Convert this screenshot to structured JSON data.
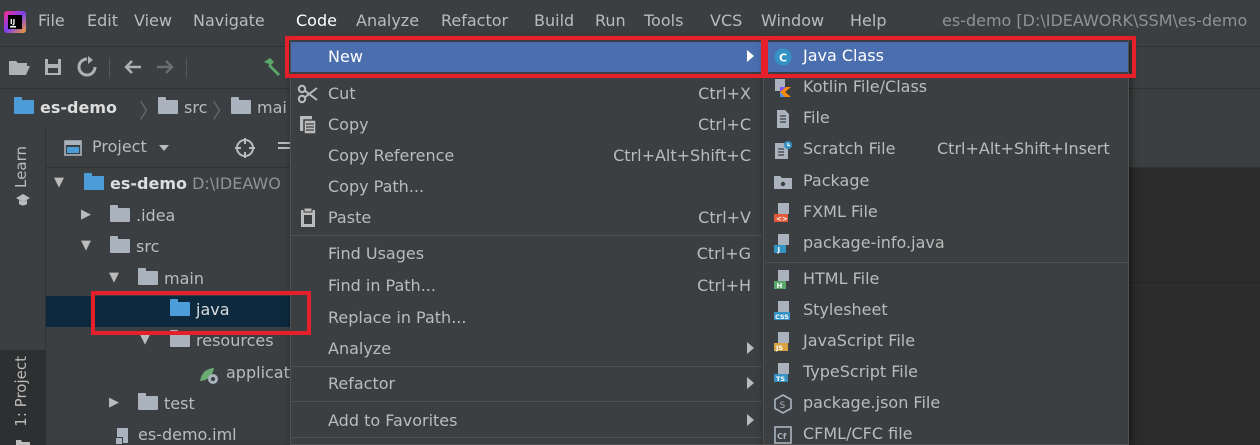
{
  "menubar": {
    "items": [
      "File",
      "Edit",
      "View",
      "Navigate",
      "Code",
      "Analyze",
      "Refactor",
      "Build",
      "Run",
      "Tools",
      "VCS",
      "Window",
      "Help"
    ],
    "window_title": "es-demo [D:\\IDEAWORK\\SSM\\es-demo"
  },
  "breadcrumb": {
    "items": [
      "es-demo",
      "src",
      "mai"
    ]
  },
  "left_strip": {
    "learn_tab": "Learn",
    "project_tab": "1: Project"
  },
  "project_panel": {
    "header_label": "Project",
    "tree": [
      {
        "label": "es-demo",
        "path": "D:\\IDEAWO"
      },
      {
        "label": ".idea"
      },
      {
        "label": "src"
      },
      {
        "label": "main"
      },
      {
        "label": "java"
      },
      {
        "label": "resources"
      },
      {
        "label": "applicat"
      },
      {
        "label": "test"
      },
      {
        "label": "es-demo.iml"
      }
    ]
  },
  "context_menu": {
    "items": [
      {
        "label": "New",
        "shortcut": ""
      },
      {
        "label": "Cut",
        "shortcut": "Ctrl+X"
      },
      {
        "label": "Copy",
        "shortcut": "Ctrl+C"
      },
      {
        "label": "Copy Reference",
        "shortcut": "Ctrl+Alt+Shift+C"
      },
      {
        "label": "Copy Path...",
        "shortcut": ""
      },
      {
        "label": "Paste",
        "shortcut": "Ctrl+V"
      },
      {
        "label": "Find Usages",
        "shortcut": "Ctrl+G"
      },
      {
        "label": "Find in Path...",
        "shortcut": "Ctrl+H"
      },
      {
        "label": "Replace in Path...",
        "shortcut": ""
      },
      {
        "label": "Analyze",
        "shortcut": ""
      },
      {
        "label": "Refactor",
        "shortcut": ""
      },
      {
        "label": "Add to Favorites",
        "shortcut": ""
      }
    ]
  },
  "new_submenu": {
    "items": [
      {
        "label": "Java Class",
        "shortcut": "",
        "icon": "java-class-icon"
      },
      {
        "label": "Kotlin File/Class",
        "shortcut": "",
        "icon": "kotlin-icon"
      },
      {
        "label": "File",
        "shortcut": "",
        "icon": "file-icon"
      },
      {
        "label": "Scratch File",
        "shortcut": "Ctrl+Alt+Shift+Insert",
        "icon": "scratch-file-icon"
      },
      {
        "label": "Package",
        "shortcut": "",
        "icon": "package-icon"
      },
      {
        "label": "FXML File",
        "shortcut": "",
        "icon": "fxml-file-icon"
      },
      {
        "label": "package-info.java",
        "shortcut": "",
        "icon": "package-info-icon"
      },
      {
        "label": "HTML File",
        "shortcut": "",
        "icon": "html-file-icon"
      },
      {
        "label": "Stylesheet",
        "shortcut": "",
        "icon": "css-file-icon"
      },
      {
        "label": "JavaScript File",
        "shortcut": "",
        "icon": "js-file-icon"
      },
      {
        "label": "TypeScript File",
        "shortcut": "",
        "icon": "ts-file-icon"
      },
      {
        "label": "package.json File",
        "shortcut": "",
        "icon": "nodejs-icon"
      },
      {
        "label": "CFML/CFC file",
        "shortcut": "",
        "icon": "cfml-icon"
      }
    ]
  },
  "colors": {
    "highlight": "#4b6eaf",
    "annotation_red": "#e5202a",
    "selection": "#0d293e"
  }
}
